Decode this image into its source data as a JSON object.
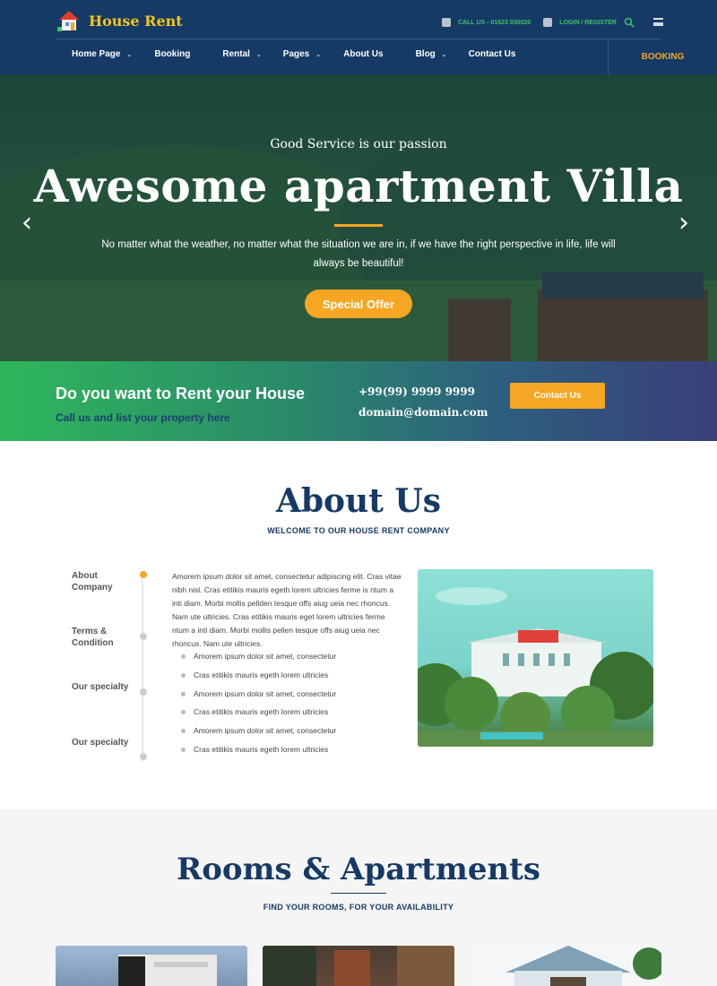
{
  "brand": {
    "name": "House Rent"
  },
  "topbar": {
    "phone": "CALL US - 01623 030020",
    "login": "LOGIN / REGISTER"
  },
  "nav": {
    "items": [
      {
        "label": "Home Page",
        "dropdown": true
      },
      {
        "label": "Booking",
        "dropdown": false
      },
      {
        "label": "Rental",
        "dropdown": true
      },
      {
        "label": "Pages",
        "dropdown": true
      },
      {
        "label": "About Us",
        "dropdown": false
      },
      {
        "label": "Blog",
        "dropdown": true
      },
      {
        "label": "Contact Us",
        "dropdown": false
      }
    ],
    "booking": "BOOKING"
  },
  "hero": {
    "subtitle": "Good Service is our passion",
    "title": "Awesome apartment Villa",
    "text": "No matter what the weather, no matter what the situation we are in, if we have the right perspective in life, life will always be beautiful!",
    "button": "Special Offer",
    "prev_icon": "chevron-left",
    "next_icon": "chevron-right"
  },
  "cta": {
    "title": "Do you want to Rent your House",
    "subtitle": "Call us and list your property here",
    "phone": "+99(99) 9999 9999",
    "email": "domain@domain.com",
    "button": "Contact Us"
  },
  "about": {
    "title": "About Us",
    "subtitle": "WELCOME TO OUR HOUSE RENT COMPANY",
    "timeline": [
      {
        "label": "About Company",
        "active": true
      },
      {
        "label": "Terms & Condition",
        "active": false
      },
      {
        "label": "Our specialty",
        "active": false
      },
      {
        "label": "Our specialty",
        "active": false
      }
    ],
    "paragraph": "Amorem ipsum dolor sit amet, consectetur adipiscing elit. Cras vitae nibh nisl. Cras etitikis mauris egeth lorem ultricies ferme is ntum a inti diam. Morbi mollis pellden tesque offs aiug ueia nec rhoncus. Nam ute ultricies. Cras etitikis mauris eget lorem ultricies ferme ntum a inti diam. Morbi mollis pellen tesque offs aiug ueia nec rhoncus. Nam ute ultricies.",
    "list": [
      "Amorem ipsum dolor sit amet, consectetur",
      "Cras etitikis mauris egeth lorem ultricies",
      "Amorem ipsum dolor sit amet, consectetur",
      "Cras etitikis mauris egeth lorem ultricies",
      "Amorem ipsum dolor sit amet, consectetur",
      "Cras etitikis mauris egeth lorem ultricies"
    ]
  },
  "rooms": {
    "title": "Rooms & Apartments",
    "subtitle": "FIND YOUR ROOMS, FOR YOUR AVAILABILITY"
  },
  "colors": {
    "navy": "#163a66",
    "accent": "#f5a623",
    "green": "#3fc16a"
  }
}
